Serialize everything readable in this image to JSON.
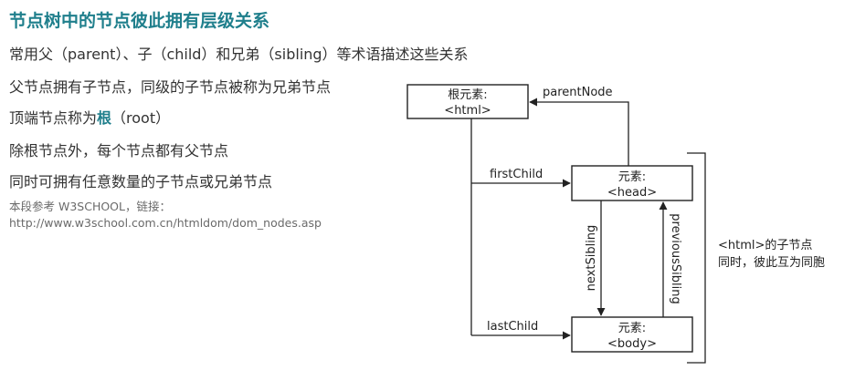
{
  "heading": "节点树中的节点彼此拥有层级关系",
  "lines": {
    "terms": "常用父（parent）、子（child）和兄弟（sibling）等术语描述这些关系",
    "parent_child": "父节点拥有子节点，同级的子节点被称为兄弟节点",
    "root_prefix": "顶端节点称为",
    "root_word": "根",
    "root_suffix": "（root）",
    "except_root": "除根节点外，每个节点都有父节点",
    "any_children": "同时可拥有任意数量的子节点或兄弟节点"
  },
  "reference": {
    "label": "本段参考 W3SCHOOL，链接：",
    "url": "http://www.w3school.com.cn/htmldom/dom_nodes.asp"
  },
  "diagram": {
    "html_node": {
      "line1": "根元素:",
      "line2": "<html>"
    },
    "head_node": {
      "line1": "元素:",
      "line2": "<head>"
    },
    "body_node": {
      "line1": "元素:",
      "line2": "<body>"
    },
    "edges": {
      "parent": "parentNode",
      "first_child": "firstChild",
      "last_child": "lastChild",
      "next_sibling": "nextSibling",
      "previous_sibling": "previousSibling"
    },
    "side_note": {
      "line1": "<html>的子节点",
      "line2": "同时，彼此互为同胞"
    }
  }
}
